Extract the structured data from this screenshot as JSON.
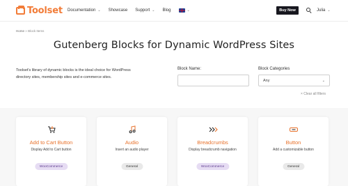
{
  "header": {
    "logo_text": "Toolset",
    "nav": [
      {
        "label": "Documentation",
        "has_dropdown": true
      },
      {
        "label": "Showcase",
        "has_dropdown": false
      },
      {
        "label": "Support",
        "has_dropdown": true
      },
      {
        "label": "Blog",
        "has_dropdown": false
      }
    ],
    "language_icon": "uk-flag-icon",
    "buy_label": "Buy Now",
    "user_name": "Julia"
  },
  "breadcrumb": {
    "home": "Home",
    "separator": "»",
    "current": "Block Items"
  },
  "page_title": "Gutenberg Blocks for Dynamic WordPress Sites",
  "intro_text": "Toolset's library of dynamic blocks is the ideal choice for WordPress directory sites, membership sites and e-commerce sites.",
  "filters": {
    "block_name_label": "Block Name:",
    "block_name_value": "",
    "block_categories_label": "Block Categories",
    "block_categories_value": "Any",
    "clear_label": "× Clear all filters"
  },
  "cards": [
    {
      "icon": "cart-icon",
      "title": "Add to Cart Button",
      "description": "Display Add to Cart button",
      "tag": "WooCommerce"
    },
    {
      "icon": "audio-icon",
      "title": "Audio",
      "description": "Insert an audio player",
      "tag": "General"
    },
    {
      "icon": "breadcrumbs-icon",
      "title": "Breadcrumbs",
      "description": "Display breadcrumb navigation",
      "tag": "WooCommerce"
    },
    {
      "icon": "button-icon",
      "title": "Button",
      "description": "Add a customizable button",
      "tag": "General"
    }
  ],
  "colors": {
    "brand_orange": "#f27c38",
    "buy_button_bg": "#17171f",
    "woocommerce_tag_bg": "#e6dcf3",
    "general_tag_bg": "#e9e9e9"
  }
}
